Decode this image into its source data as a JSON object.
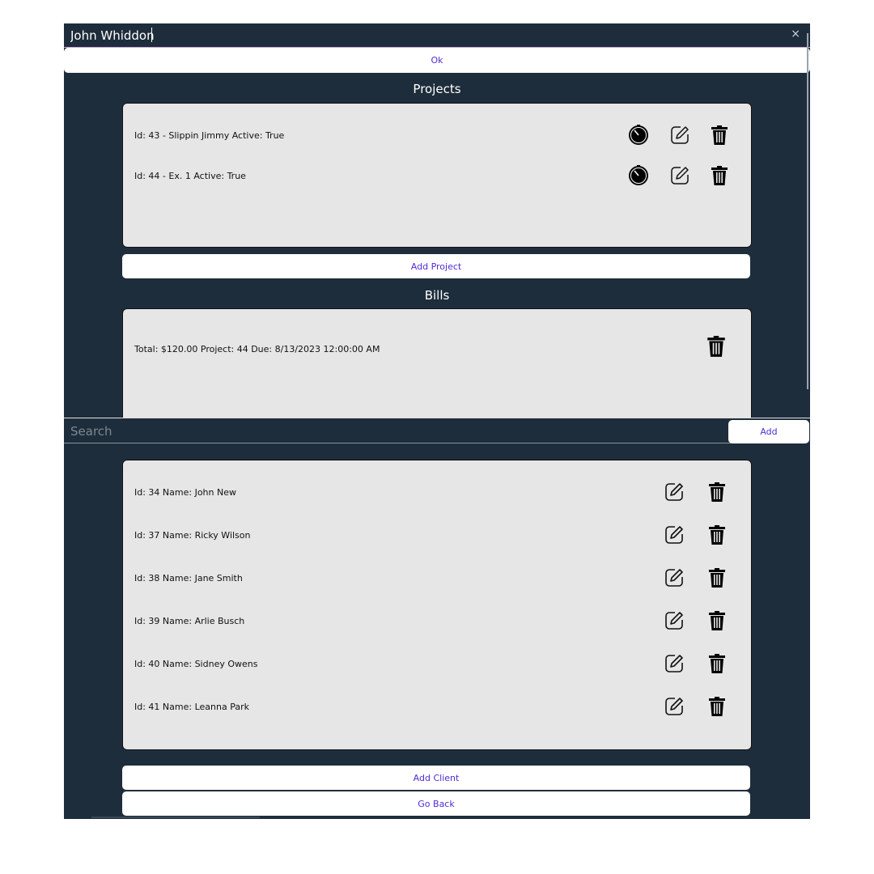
{
  "client_editor": {
    "name_value": "John Whiddon",
    "close_glyph": "×",
    "ok_label": "Ok",
    "projects_title": "Projects",
    "projects": [
      {
        "label": "Id: 43 - Slippin Jimmy Active: True"
      },
      {
        "label": "Id: 44 - Ex. 1 Active: True"
      }
    ],
    "add_project_label": "Add Project",
    "bills_title": "Bills",
    "bills": [
      {
        "label": "Total: $120.00 Project: 44 Due: 8/13/2023 12:00:00 AM"
      }
    ]
  },
  "clients_page": {
    "search_placeholder": "Search",
    "add_label": "Add",
    "clients": [
      {
        "label": "Id: 34 Name: John New"
      },
      {
        "label": "Id: 37 Name: Ricky Wilson"
      },
      {
        "label": "Id: 38 Name: Jane Smith"
      },
      {
        "label": "Id: 39 Name: Arlie Busch"
      },
      {
        "label": "Id: 40 Name: Sidney Owens"
      },
      {
        "label": "Id: 41 Name: Leanna Park"
      }
    ],
    "add_client_label": "Add Client",
    "go_back_label": "Go Back"
  },
  "icons": {
    "timer": "timer-icon",
    "edit": "edit-icon",
    "delete": "trash-icon",
    "close": "close-icon"
  },
  "colors": {
    "background": "#1e2d3b",
    "panel": "#e6e6e6",
    "button_text": "#512bd4"
  }
}
